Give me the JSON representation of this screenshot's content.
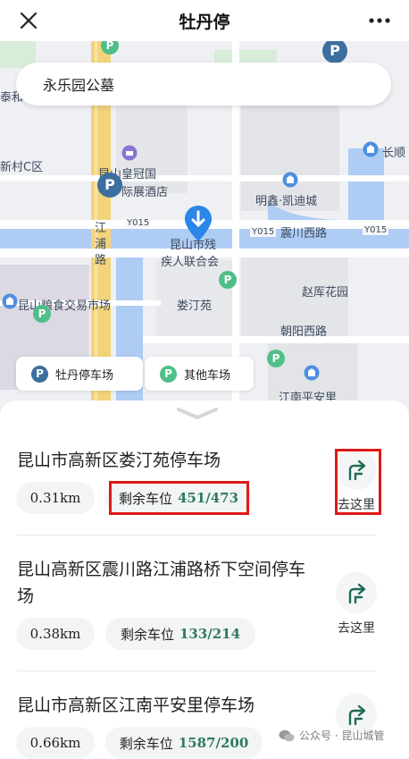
{
  "header": {
    "title": "牡丹停"
  },
  "search": {
    "value": "永乐园公墓"
  },
  "map": {
    "labels": [
      "昆山皇冠国",
      "际展酒店",
      "江",
      "浦",
      "路",
      "昆山市残",
      "疾人联合会",
      "娄汀苑",
      "明鑫·凯迪城",
      "长顺",
      "震川西路",
      "赵厍花园",
      "朝阳西路",
      "昆山粮食交易市场",
      "江南平安里",
      "新村C区",
      "泰和"
    ],
    "road_tags": [
      "Y015",
      "Y015",
      "Y015"
    ]
  },
  "legend": [
    {
      "label": "牡丹停车场",
      "color": "#3d6f9e",
      "glyph": "P"
    },
    {
      "label": "其他车场",
      "color": "#4fbf88",
      "glyph": "P"
    }
  ],
  "lots": [
    {
      "name": "昆山市高新区娄汀苑停车场",
      "distance": "0.31km",
      "spaces_label": "剩余车位",
      "spaces": "451/473",
      "nav_label": "去这里"
    },
    {
      "name": "昆山高新区震川路江浦路桥下空间停车场",
      "distance": "0.38km",
      "spaces_label": "剩余车位",
      "spaces": "133/214",
      "nav_label": "去这里"
    },
    {
      "name": "昆山市高新区江南平安里停车场",
      "distance": "0.66km",
      "spaces_label": "剩余车位",
      "spaces": "1587/200",
      "nav_label": "去这里"
    }
  ],
  "watermark": "公众号 · 昆山城管"
}
